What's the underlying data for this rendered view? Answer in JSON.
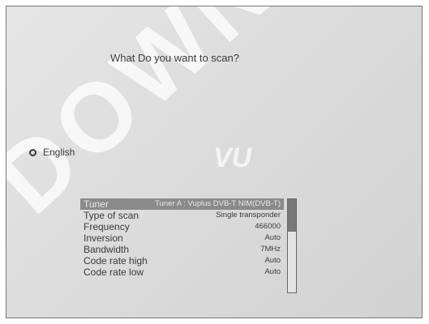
{
  "watermark": "DOWNLOAD",
  "logo": "VU",
  "question": "What Do you want to scan?",
  "language_option": {
    "label": "English",
    "selected": false
  },
  "settings": [
    {
      "label": "Tuner",
      "value": "Tuner A : Vuplus DVB-T NIM(DVB-T)"
    },
    {
      "label": "Type of scan",
      "value": "Single transponder"
    },
    {
      "label": "Frequency",
      "value": "466000"
    },
    {
      "label": "Inversion",
      "value": "Auto"
    },
    {
      "label": "Bandwidth",
      "value": "7MHz"
    },
    {
      "label": "Code rate high",
      "value": "Auto"
    },
    {
      "label": "Code rate low",
      "value": "Auto"
    }
  ],
  "selected_index": 0,
  "scroll_fraction": 0.35
}
